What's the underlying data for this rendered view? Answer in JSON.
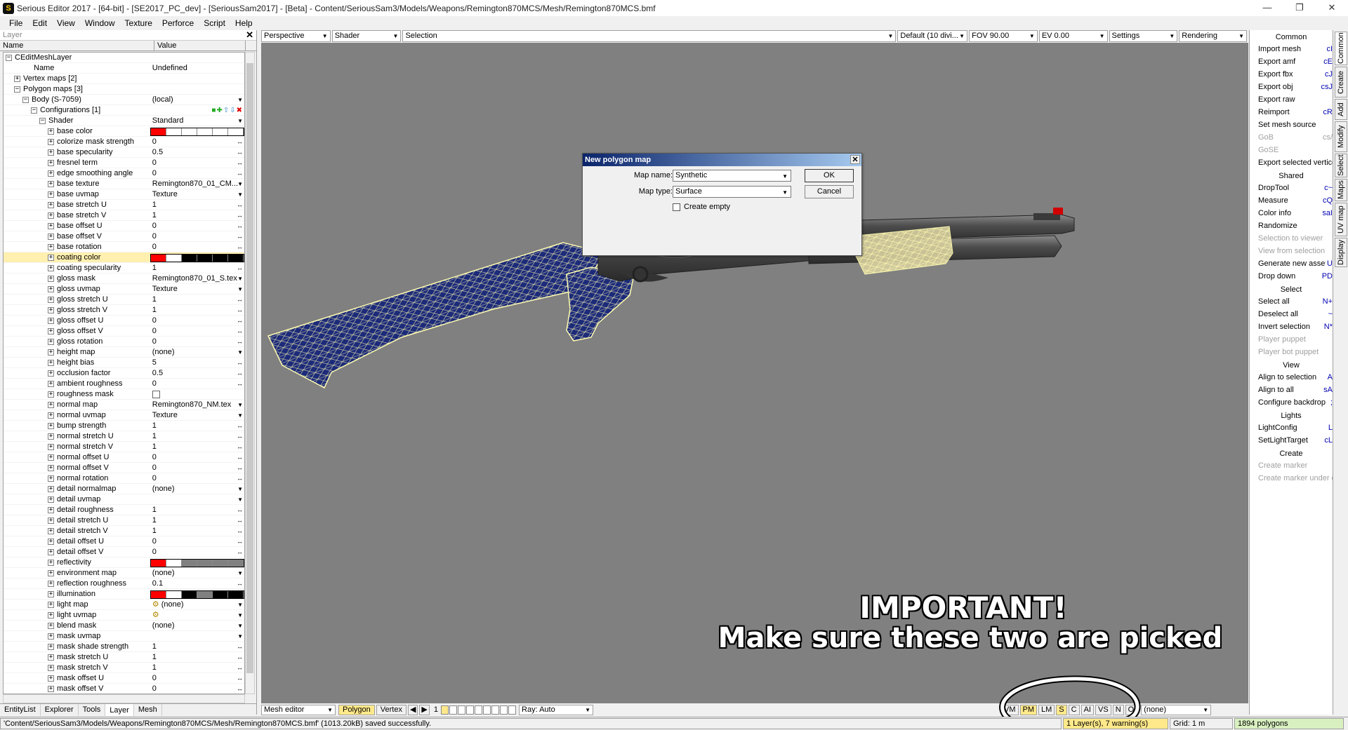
{
  "window": {
    "title": "Serious Editor 2017 - [64-bit] - [SE2017_PC_dev] - [SeriousSam2017] - [Beta] - Content/SeriousSam3/Models/Weapons/Remington870MCS/Mesh/Remington870MCS.bmf",
    "app_icon": "serious-sam-icon"
  },
  "menu": [
    "File",
    "Edit",
    "View",
    "Window",
    "Texture",
    "Perforce",
    "Script",
    "Help"
  ],
  "left_panel": {
    "title": "Layer",
    "col_name": "Name",
    "col_value": "Value",
    "tabs": [
      "EntityList",
      "Explorer",
      "Tools",
      "Layer",
      "Mesh"
    ],
    "active_tab": "Layer",
    "rows": [
      {
        "indent": 0,
        "exp": "-",
        "name": "CEditMeshLayer",
        "value": ""
      },
      {
        "indent": 1,
        "exp": "",
        "name": "Name",
        "value": "Undefined"
      },
      {
        "indent": 1,
        "exp": "+",
        "name": "Vertex maps [2]",
        "value": ""
      },
      {
        "indent": 1,
        "exp": "-",
        "name": "Polygon maps [3]",
        "value": ""
      },
      {
        "indent": 2,
        "exp": "-",
        "name": "Body (S-7059)",
        "value": "(local)",
        "ctrl": "dd"
      },
      {
        "indent": 3,
        "exp": "-",
        "name": "Configurations [1]",
        "value": "",
        "ctrl": "icons"
      },
      {
        "indent": 4,
        "exp": "-",
        "name": "Shader",
        "value": "Standard",
        "ctrl": "dd"
      },
      {
        "indent": 5,
        "exp": "+",
        "name": "base color",
        "value": "",
        "swatch": [
          "#ff0000",
          "#ffffff",
          "#ffffff",
          "#ffffff",
          "#ffffff",
          "#ffffff"
        ]
      },
      {
        "indent": 5,
        "exp": "+",
        "name": "colorize mask strength",
        "value": "0",
        "ctrl": "lr"
      },
      {
        "indent": 5,
        "exp": "+",
        "name": "base specularity",
        "value": "0.5",
        "ctrl": "lr"
      },
      {
        "indent": 5,
        "exp": "+",
        "name": "fresnel term",
        "value": "0",
        "ctrl": "lr"
      },
      {
        "indent": 5,
        "exp": "+",
        "name": "edge smoothing angle",
        "value": "0",
        "ctrl": "lr"
      },
      {
        "indent": 5,
        "exp": "+",
        "name": "base texture",
        "value": "Remington870_01_CM...",
        "ctrl": "dd"
      },
      {
        "indent": 5,
        "exp": "+",
        "name": "base uvmap",
        "value": "Texture",
        "ctrl": "dd"
      },
      {
        "indent": 5,
        "exp": "+",
        "name": "base stretch U",
        "value": "1",
        "ctrl": "lr"
      },
      {
        "indent": 5,
        "exp": "+",
        "name": "base stretch V",
        "value": "1",
        "ctrl": "lr"
      },
      {
        "indent": 5,
        "exp": "+",
        "name": "base offset U",
        "value": "0",
        "ctrl": "lr"
      },
      {
        "indent": 5,
        "exp": "+",
        "name": "base offset V",
        "value": "0",
        "ctrl": "lr"
      },
      {
        "indent": 5,
        "exp": "+",
        "name": "base rotation",
        "value": "0",
        "ctrl": "lr"
      },
      {
        "indent": 5,
        "exp": "+",
        "name": "coating color",
        "value": "",
        "sel": true,
        "swatch": [
          "#ff0000",
          "#ffffff",
          "#000000",
          "#000000",
          "#000000",
          "#000000"
        ]
      },
      {
        "indent": 5,
        "exp": "+",
        "name": "coating specularity",
        "value": "1",
        "ctrl": "lr"
      },
      {
        "indent": 5,
        "exp": "+",
        "name": "gloss mask",
        "value": "Remington870_01_S.tex",
        "ctrl": "dd"
      },
      {
        "indent": 5,
        "exp": "+",
        "name": "gloss uvmap",
        "value": "Texture",
        "ctrl": "dd"
      },
      {
        "indent": 5,
        "exp": "+",
        "name": "gloss stretch U",
        "value": "1",
        "ctrl": "lr"
      },
      {
        "indent": 5,
        "exp": "+",
        "name": "gloss stretch V",
        "value": "1",
        "ctrl": "lr"
      },
      {
        "indent": 5,
        "exp": "+",
        "name": "gloss offset U",
        "value": "0",
        "ctrl": "lr"
      },
      {
        "indent": 5,
        "exp": "+",
        "name": "gloss offset V",
        "value": "0",
        "ctrl": "lr"
      },
      {
        "indent": 5,
        "exp": "+",
        "name": "gloss rotation",
        "value": "0",
        "ctrl": "lr"
      },
      {
        "indent": 5,
        "exp": "+",
        "name": "height map",
        "value": "(none)",
        "ctrl": "dd"
      },
      {
        "indent": 5,
        "exp": "+",
        "name": "height bias",
        "value": "5",
        "ctrl": "lr"
      },
      {
        "indent": 5,
        "exp": "+",
        "name": "occlusion factor",
        "value": "0.5",
        "ctrl": "lr"
      },
      {
        "indent": 5,
        "exp": "+",
        "name": "ambient roughness",
        "value": "0",
        "ctrl": "lr"
      },
      {
        "indent": 5,
        "exp": "+",
        "name": "roughness mask",
        "value": "",
        "ctrl": "check"
      },
      {
        "indent": 5,
        "exp": "+",
        "name": "normal map",
        "value": "Remington870_NM.tex",
        "ctrl": "dd"
      },
      {
        "indent": 5,
        "exp": "+",
        "name": "normal uvmap",
        "value": "Texture",
        "ctrl": "dd"
      },
      {
        "indent": 5,
        "exp": "+",
        "name": "bump strength",
        "value": "1",
        "ctrl": "lr"
      },
      {
        "indent": 5,
        "exp": "+",
        "name": "normal stretch U",
        "value": "1",
        "ctrl": "lr"
      },
      {
        "indent": 5,
        "exp": "+",
        "name": "normal stretch V",
        "value": "1",
        "ctrl": "lr"
      },
      {
        "indent": 5,
        "exp": "+",
        "name": "normal offset U",
        "value": "0",
        "ctrl": "lr"
      },
      {
        "indent": 5,
        "exp": "+",
        "name": "normal offset V",
        "value": "0",
        "ctrl": "lr"
      },
      {
        "indent": 5,
        "exp": "+",
        "name": "normal rotation",
        "value": "0",
        "ctrl": "lr"
      },
      {
        "indent": 5,
        "exp": "+",
        "name": "detail normalmap",
        "value": "(none)",
        "ctrl": "dd"
      },
      {
        "indent": 5,
        "exp": "+",
        "name": "detail uvmap",
        "value": "",
        "ctrl": "dd"
      },
      {
        "indent": 5,
        "exp": "+",
        "name": "detail roughness",
        "value": "1",
        "ctrl": "lr"
      },
      {
        "indent": 5,
        "exp": "+",
        "name": "detail stretch U",
        "value": "1",
        "ctrl": "lr"
      },
      {
        "indent": 5,
        "exp": "+",
        "name": "detail stretch V",
        "value": "1",
        "ctrl": "lr"
      },
      {
        "indent": 5,
        "exp": "+",
        "name": "detail offset U",
        "value": "0",
        "ctrl": "lr"
      },
      {
        "indent": 5,
        "exp": "+",
        "name": "detail offset V",
        "value": "0",
        "ctrl": "lr"
      },
      {
        "indent": 5,
        "exp": "+",
        "name": "reflectivity",
        "value": "",
        "swatch": [
          "#ff0000",
          "#ffffff",
          "#808080",
          "#808080",
          "#808080",
          "#808080"
        ]
      },
      {
        "indent": 5,
        "exp": "+",
        "name": "environment map",
        "value": "(none)",
        "ctrl": "dd"
      },
      {
        "indent": 5,
        "exp": "+",
        "name": "reflection roughness",
        "value": "0.1",
        "ctrl": "lr"
      },
      {
        "indent": 5,
        "exp": "+",
        "name": "illumination",
        "value": "",
        "swatch": [
          "#ff0000",
          "#ffffff",
          "#000000",
          "#808080",
          "#000000",
          "#000000"
        ]
      },
      {
        "indent": 5,
        "exp": "+",
        "name": "light map",
        "value": "(none)",
        "ctrl": "dd",
        "icon": true
      },
      {
        "indent": 5,
        "exp": "+",
        "name": "light uvmap",
        "value": "",
        "ctrl": "dd",
        "icon": true
      },
      {
        "indent": 5,
        "exp": "+",
        "name": "blend mask",
        "value": "(none)",
        "ctrl": "dd"
      },
      {
        "indent": 5,
        "exp": "+",
        "name": "mask uvmap",
        "value": "",
        "ctrl": "dd"
      },
      {
        "indent": 5,
        "exp": "+",
        "name": "mask shade strength",
        "value": "1",
        "ctrl": "lr"
      },
      {
        "indent": 5,
        "exp": "+",
        "name": "mask stretch U",
        "value": "1",
        "ctrl": "lr"
      },
      {
        "indent": 5,
        "exp": "+",
        "name": "mask stretch V",
        "value": "1",
        "ctrl": "lr"
      },
      {
        "indent": 5,
        "exp": "+",
        "name": "mask offset U",
        "value": "0",
        "ctrl": "lr"
      },
      {
        "indent": 5,
        "exp": "+",
        "name": "mask offset V",
        "value": "0",
        "ctrl": "lr"
      }
    ]
  },
  "viewport_toolbar": {
    "projection": "Perspective",
    "render_mode": "Shader",
    "selection": "Selection",
    "grid": "Default (10 divi...",
    "fov": "FOV 90.00",
    "ev": "EV  0.00",
    "settings": "Settings",
    "rendering": "Rendering"
  },
  "dialog": {
    "title": "New polygon map",
    "map_name_label": "Map name:",
    "map_name_value": "Synthetic",
    "map_type_label": "Map type:",
    "map_type_value": "Surface",
    "create_empty_label": "Create empty",
    "ok_label": "OK",
    "cancel_label": "Cancel"
  },
  "viewport_bottom": {
    "editor": "Mesh editor",
    "polygon_tab": "Polygon",
    "vertex_tab": "Vertex",
    "page_number": "1",
    "ray": "Ray: Auto",
    "toggles": [
      "VM",
      "PM",
      "LM",
      "S",
      "C",
      "AI",
      "VS",
      "N",
      "O"
    ],
    "active_toggles": [
      "PM",
      "S"
    ],
    "target": "(none)"
  },
  "right_panel": {
    "sections": [
      {
        "title": "Common",
        "items": [
          {
            "label": "Import mesh",
            "sc": "cI",
            "dis": false
          },
          {
            "label": "Export amf",
            "sc": "cE",
            "dis": false
          },
          {
            "label": "Export fbx",
            "sc": "cJ",
            "dis": false
          },
          {
            "label": "Export obj",
            "sc": "csJ",
            "dis": false
          },
          {
            "label": "Export raw",
            "sc": "",
            "dis": false
          },
          {
            "label": "Reimport",
            "sc": "cR",
            "dis": false
          },
          {
            "label": "Set mesh source",
            "sc": "",
            "dis": false
          },
          {
            "label": "GoB",
            "sc": "cs/",
            "dis": true
          },
          {
            "label": "GoSE",
            "sc": "",
            "dis": true
          },
          {
            "label": "Export selected vertices",
            "sc": "",
            "dis": false
          }
        ]
      },
      {
        "title": "Shared",
        "items": [
          {
            "label": "DropTool",
            "sc": "c~",
            "dis": false
          },
          {
            "label": "Measure",
            "sc": "cQ",
            "dis": false
          },
          {
            "label": "Color info",
            "sc": "saI",
            "dis": false
          },
          {
            "label": "Randomize",
            "sc": "",
            "dis": false
          },
          {
            "label": "Selection to viewer",
            "sc": "",
            "dis": true
          },
          {
            "label": "View from selection",
            "sc": "",
            "dis": true
          },
          {
            "label": "Generate new asset",
            "sc": "U",
            "dis": false
          },
          {
            "label": "Drop down",
            "sc": "PD",
            "dis": false
          }
        ]
      },
      {
        "title": "Select",
        "items": [
          {
            "label": "Select all",
            "sc": "N+",
            "dis": false
          },
          {
            "label": "Deselect all",
            "sc": "~",
            "dis": false
          },
          {
            "label": "Invert selection",
            "sc": "N*",
            "dis": false
          },
          {
            "label": "Player puppet",
            "sc": "",
            "dis": true
          },
          {
            "label": "Player bot puppet",
            "sc": "",
            "dis": true
          }
        ]
      },
      {
        "title": "View",
        "items": [
          {
            "label": "Align to selection",
            "sc": "A",
            "dis": false
          },
          {
            "label": "Align to all",
            "sc": "sA",
            "dis": false
          },
          {
            "label": "Configure backdrop",
            "sc": ";",
            "dis": false
          }
        ]
      },
      {
        "title": "Lights",
        "items": [
          {
            "label": "LightConfig",
            "sc": "L",
            "dis": false
          },
          {
            "label": "SetLightTarget",
            "sc": "cL",
            "dis": false
          }
        ]
      },
      {
        "title": "Create",
        "items": [
          {
            "label": "Create marker",
            "sc": "",
            "dis": true
          },
          {
            "label": "Create marker under cursor",
            "sc": "",
            "dis": true
          }
        ]
      }
    ],
    "vtabs": [
      "Common",
      "Create",
      "Add",
      "Modify",
      "Select",
      "Maps",
      "UV map",
      "Display"
    ]
  },
  "status": {
    "message": "'Content/SeriousSam3/Models/Weapons/Remington870MCS/Mesh/Remington870MCS.bmf' (1013.20kB) saved successfully.",
    "warnings": "1 Layer(s), 7 warning(s)",
    "grid": "Grid: 1 m",
    "polygons": "1894 polygons"
  },
  "overlay": {
    "headline": "IMPORTANT!",
    "subline": "Make sure these two are picked"
  },
  "colors": {
    "viewport_bg": "#808080",
    "highlight": "#ffe98a",
    "wireframe": "#fffcb0",
    "mesh_blue": "#1c2a7a"
  }
}
